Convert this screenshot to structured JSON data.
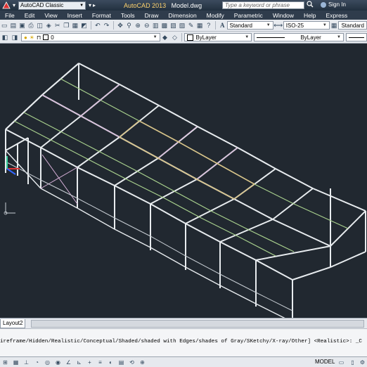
{
  "title_bar": {
    "workspace": "AutoCAD Classic",
    "app_name": "AutoCAD 2013",
    "file_name": "Model.dwg",
    "search_placeholder": "Type a keyword or phrase",
    "sign_in": "Sign In"
  },
  "menu": [
    "File",
    "Edit",
    "View",
    "Insert",
    "Format",
    "Tools",
    "Draw",
    "Dimension",
    "Modify",
    "Parametric",
    "Window",
    "Help",
    "Express"
  ],
  "toolbar1": {
    "text_style": "Standard",
    "dim_style": "ISO-25",
    "table_style": "Standard"
  },
  "toolbar2": {
    "layer": "0",
    "color": "ByLayer",
    "linetype": "ByLayer"
  },
  "layout_tab": "Layout2",
  "command_line": "ireframe/Hidden/Realistic/Conceptual/Shaded/shaded with Edges/shades of Gray/SKetchy/X-ray/Other] <Realistic>: _C",
  "status_bar": {
    "model": "MODEL"
  },
  "icons": [
    "app-menu-icon",
    "new-icon",
    "open-icon",
    "save-icon",
    "undo-icon",
    "redo-icon",
    "pan-icon",
    "zoom-icon",
    "layer-icon",
    "ucs-icon",
    "search-icon",
    "sign-in-icon"
  ],
  "colors": {
    "background": "#212830",
    "frame_white": "#e8ecef",
    "frame_green": "#a8d08d",
    "frame_yellow": "#d8c48a",
    "frame_pink": "#d7b0d8"
  }
}
